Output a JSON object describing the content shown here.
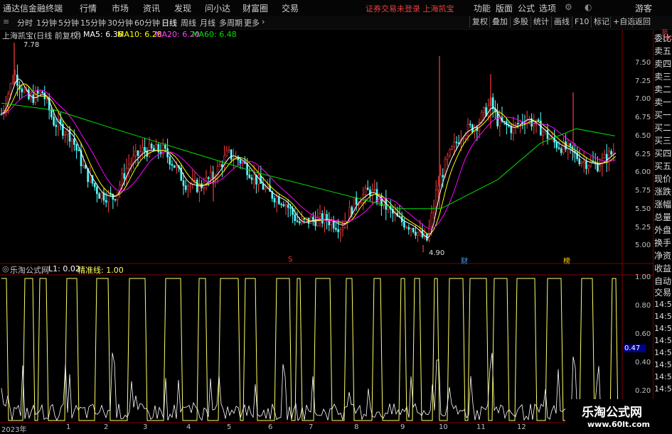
{
  "app": {
    "title": "通达信金融终端",
    "notice": "证券交易未登录 上海凯宝"
  },
  "menu": [
    "行情",
    "市场",
    "资讯",
    "发现",
    "问小达",
    "财富圈",
    "交易"
  ],
  "right_menu": [
    "功能",
    "版面",
    "公式",
    "选项",
    "游客"
  ],
  "periods": [
    "分时",
    "1分钟",
    "5分钟",
    "15分钟",
    "30分钟",
    "60分钟",
    "日线",
    "周线",
    "月线",
    "多周期",
    "更多"
  ],
  "active_period": "日线",
  "toolbar_right": [
    "复权",
    "叠加",
    "多股",
    "统计",
    "画线",
    "F10",
    "标记",
    "+自选",
    "返回"
  ],
  "stock": {
    "name": "上海凯宝(日线 前复权)",
    "ma5": "MA5: 6.36",
    "ma10": "MA10: 6.28",
    "ma20": "MA20: 6.20",
    "ma60": "MA60: 6.48",
    "high_label": "7.78",
    "low_label": "4.90"
  },
  "price_axis": [
    "7.50",
    "7.25",
    "7.00",
    "6.75",
    "6.50",
    "6.25",
    "6.00",
    "5.75",
    "5.50",
    "5.25",
    "5.00"
  ],
  "sidebar": [
    "委比",
    "卖五",
    "卖四",
    "卖三",
    "卖二",
    "卖一",
    "买一",
    "买二",
    "买三",
    "买四",
    "买五",
    "现价",
    "涨跌",
    "涨幅",
    "总量",
    "外盘",
    "换手",
    "净资",
    "收益"
  ],
  "sidebar_top": "阳\n1000",
  "sidebar2": [
    "自动",
    "交易",
    "14:56",
    "14:56",
    "14:56",
    "14:56",
    "14:56",
    "14:56",
    "14:56",
    "14:56"
  ],
  "indicator": {
    "title": "乐淘公式网",
    "l1": "L1: 0.02",
    "line": "精准线: 1.00",
    "current": "0.47"
  },
  "ind_axis": [
    "1.00",
    "0.80",
    "0.60",
    "0.40",
    "0.20"
  ],
  "x_labels": [
    "2023年",
    "1",
    "2",
    "3",
    "4",
    "5",
    "6",
    "7",
    "8",
    "9",
    "10",
    "11",
    "12"
  ],
  "markers": [
    {
      "text": "S",
      "color": "#ff3030"
    },
    {
      "text": "财",
      "color": "#40a0ff"
    },
    {
      "text": "榜",
      "color": "#ffcc00"
    }
  ],
  "watermark": {
    "line1": "乐淘公式网",
    "line2": "www.60lt.com"
  },
  "colors": {
    "up": "#ff3c3c",
    "down": "#54ffff",
    "ma5": "#ffffff",
    "ma10": "#ffff00",
    "ma20": "#ff00ff",
    "ma60": "#00e000",
    "indicator": "#ffff66"
  }
}
